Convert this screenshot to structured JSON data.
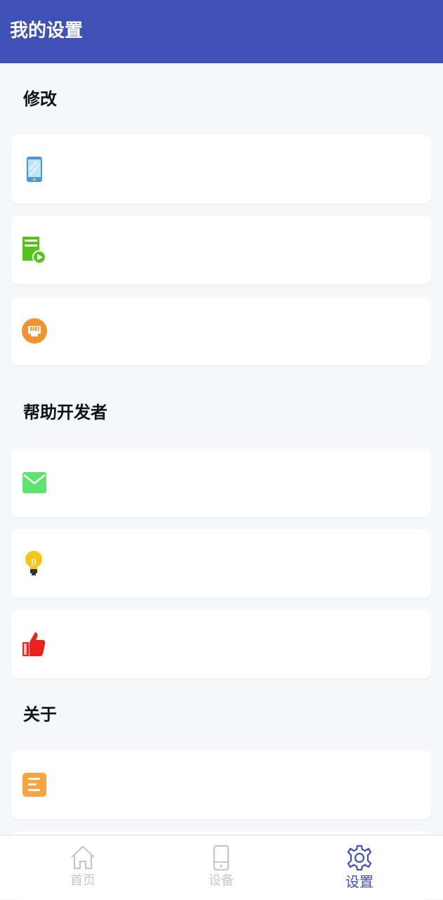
{
  "header": {
    "title": "我的设置"
  },
  "sections": [
    {
      "title": "修改",
      "items": [
        {
          "icon": "phone-icon",
          "label": ""
        },
        {
          "icon": "server-play-icon",
          "label": ""
        },
        {
          "icon": "ethernet-icon",
          "label": ""
        }
      ]
    },
    {
      "title": "帮助开发者",
      "items": [
        {
          "icon": "mail-icon",
          "label": ""
        },
        {
          "icon": "lightbulb-icon",
          "label": ""
        },
        {
          "icon": "thumbs-up-icon",
          "label": ""
        }
      ]
    },
    {
      "title": "关于",
      "items": [
        {
          "icon": "document-icon",
          "label": ""
        }
      ]
    }
  ],
  "bottom_nav": {
    "items": [
      {
        "label": "首页",
        "icon": "home-icon",
        "active": false
      },
      {
        "label": "设备",
        "icon": "device-icon",
        "active": false
      },
      {
        "label": "设置",
        "icon": "gear-icon",
        "active": true
      }
    ]
  },
  "colors": {
    "primary": "#3f51b5",
    "background": "#f6f7f9",
    "inactive": "#c6c6c6"
  }
}
